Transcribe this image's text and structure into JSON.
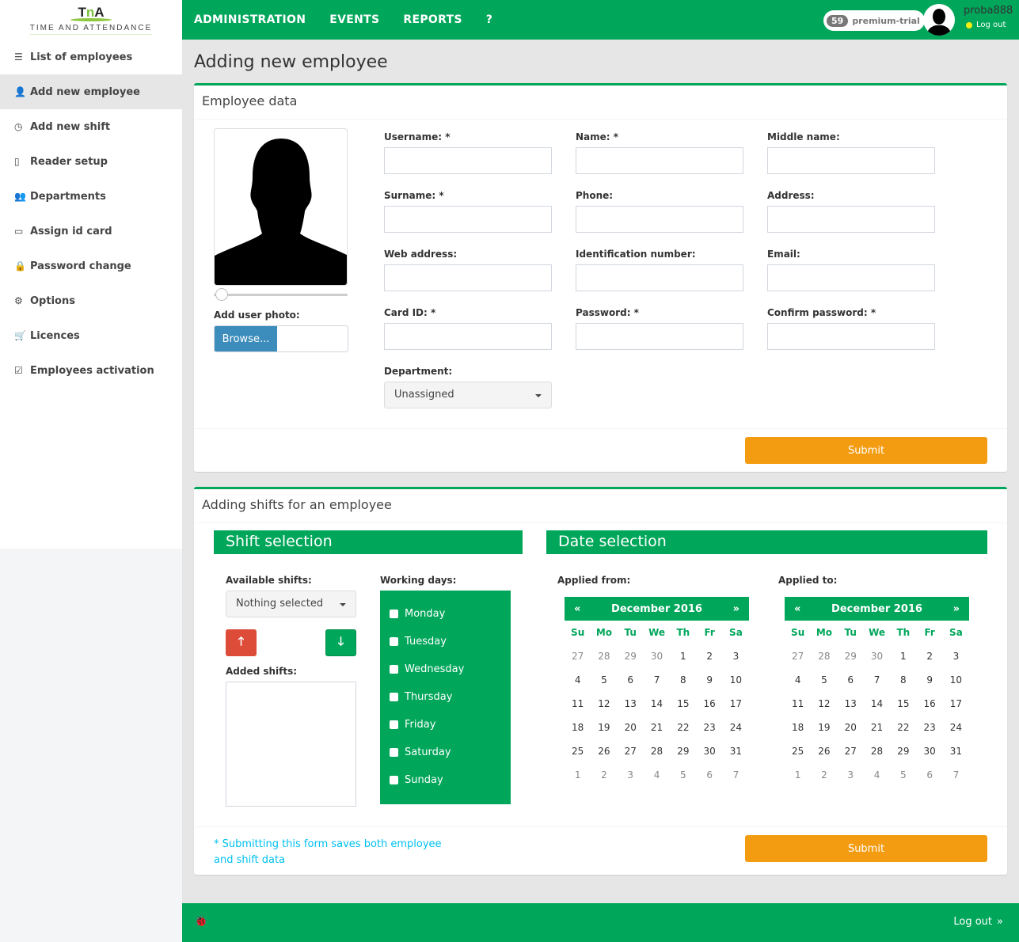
{
  "brand": {
    "logo_mark_a": "T",
    "logo_mark_n": "n",
    "logo_mark_b": "A",
    "logo_sub": "TIME AND ATTENDANCE"
  },
  "sidebar": {
    "items": [
      {
        "label": "List of employees",
        "icon": "list-icon",
        "glyph": "☰",
        "active": false
      },
      {
        "label": "Add new employee",
        "icon": "user-plus-icon",
        "glyph": "👤",
        "active": true
      },
      {
        "label": "Add new shift",
        "icon": "clock-icon",
        "glyph": "◷",
        "active": false
      },
      {
        "label": "Reader setup",
        "icon": "tablet-icon",
        "glyph": "▯",
        "active": false
      },
      {
        "label": "Departments",
        "icon": "users-icon",
        "glyph": "👥",
        "active": false
      },
      {
        "label": "Assign id card",
        "icon": "credit-card-icon",
        "glyph": "▭",
        "active": false
      },
      {
        "label": "Password change",
        "icon": "lock-icon",
        "glyph": "🔒",
        "active": false
      },
      {
        "label": "Options",
        "icon": "gear-icon",
        "glyph": "⚙",
        "active": false
      },
      {
        "label": "Licences",
        "icon": "cart-icon",
        "glyph": "🛒",
        "active": false
      },
      {
        "label": "Employees activation",
        "icon": "check-square-icon",
        "glyph": "☑",
        "active": false
      }
    ]
  },
  "topbar": {
    "nav": [
      "ADMINISTRATION",
      "EVENTS",
      "REPORTS",
      "?"
    ],
    "badge_count": "59",
    "badge_label": "premium-trial",
    "username": "proba888",
    "logout": "Log out",
    "status_color": "#f5ee10"
  },
  "page_title": "Adding new employee",
  "employee_box": {
    "title": "Employee data",
    "add_photo_label": "Add user photo:",
    "browse_label": "Browse...",
    "photo_zoom": 0,
    "fields": [
      {
        "label": "Username: *",
        "value": ""
      },
      {
        "label": "Name: *",
        "value": ""
      },
      {
        "label": "Middle name:",
        "value": ""
      },
      {
        "label": "Surname: *",
        "value": ""
      },
      {
        "label": "Phone:",
        "value": ""
      },
      {
        "label": "Address:",
        "value": ""
      },
      {
        "label": "Web address:",
        "value": ""
      },
      {
        "label": "Identification number:",
        "value": ""
      },
      {
        "label": "Email:",
        "value": ""
      },
      {
        "label": "Card ID: *",
        "value": ""
      },
      {
        "label": "Password: *",
        "value": ""
      },
      {
        "label": "Confirm password: *",
        "value": ""
      }
    ],
    "department_label": "Department:",
    "department_value": "Unassigned",
    "submit": "Submit"
  },
  "shifts_box": {
    "title": "Adding shifts for an employee",
    "shift_selection": "Shift selection",
    "date_selection": "Date selection",
    "available_label": "Available shifts:",
    "available_value": "Nothing selected",
    "added_label": "Added shifts:",
    "working_days_label": "Working days:",
    "days": [
      "Monday",
      "Tuesday",
      "Wednesday",
      "Thursday",
      "Friday",
      "Saturday",
      "Sunday"
    ],
    "applied_from_label": "Applied from:",
    "applied_to_label": "Applied to:",
    "note": "* Submitting this form saves both employee and shift data",
    "submit": "Submit",
    "calendar": {
      "month": "December 2016",
      "prev": "«",
      "next": "»",
      "dow": [
        "Su",
        "Mo",
        "Tu",
        "We",
        "Th",
        "Fr",
        "Sa"
      ],
      "weeks": [
        [
          "27",
          "28",
          "29",
          "30",
          "1",
          "2",
          "3"
        ],
        [
          "4",
          "5",
          "6",
          "7",
          "8",
          "9",
          "10"
        ],
        [
          "11",
          "12",
          "13",
          "14",
          "15",
          "16",
          "17"
        ],
        [
          "18",
          "19",
          "20",
          "21",
          "22",
          "23",
          "24"
        ],
        [
          "25",
          "26",
          "27",
          "28",
          "29",
          "30",
          "31"
        ],
        [
          "1",
          "2",
          "3",
          "4",
          "5",
          "6",
          "7"
        ]
      ]
    }
  },
  "footer": {
    "logout": "Log out",
    "logout_icon": "»"
  },
  "colors": {
    "primary": "#00a65a",
    "submit": "#f39c12",
    "danger": "#dd4b39",
    "browse": "#3c8dbc",
    "note": "#00c0ef"
  }
}
